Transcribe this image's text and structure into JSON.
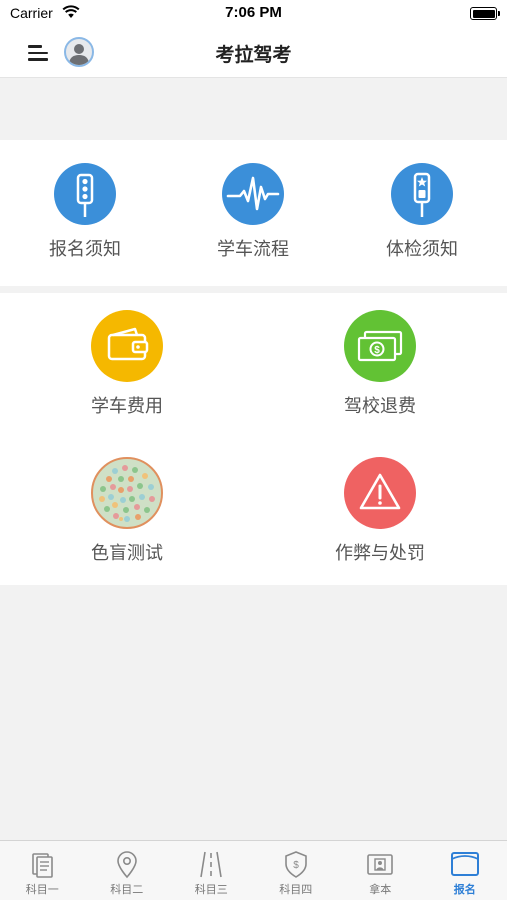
{
  "status_bar": {
    "carrier": "Carrier",
    "time": "7:06 PM"
  },
  "nav": {
    "title": "考拉驾考",
    "menu_icon": "menu-icon",
    "avatar_icon": "avatar-icon"
  },
  "colors": {
    "blue": "#3b8fd9",
    "yellow": "#f5b800",
    "green": "#62c234",
    "red": "#ef6262",
    "active_tab": "#2e7fd6"
  },
  "section_top": {
    "items": [
      {
        "label": "报名须知",
        "icon": "traffic-light-icon"
      },
      {
        "label": "学车流程",
        "icon": "heartbeat-icon"
      },
      {
        "label": "体检须知",
        "icon": "signal-icon"
      }
    ]
  },
  "section_bottom": {
    "items": [
      {
        "label": "学车费用",
        "icon": "wallet-icon"
      },
      {
        "label": "驾校退费",
        "icon": "money-icon"
      },
      {
        "label": "色盲测试",
        "icon": "color-blind-test-icon"
      },
      {
        "label": "作弊与处罚",
        "icon": "warning-icon"
      }
    ]
  },
  "tab_bar": {
    "tabs": [
      {
        "label": "科目一",
        "icon": "document-icon"
      },
      {
        "label": "科目二",
        "icon": "location-pin-icon"
      },
      {
        "label": "科目三",
        "icon": "road-icon"
      },
      {
        "label": "科目四",
        "icon": "shield-icon"
      },
      {
        "label": "拿本",
        "icon": "license-icon"
      },
      {
        "label": "报名",
        "icon": "card-icon"
      }
    ],
    "active": "报名"
  }
}
